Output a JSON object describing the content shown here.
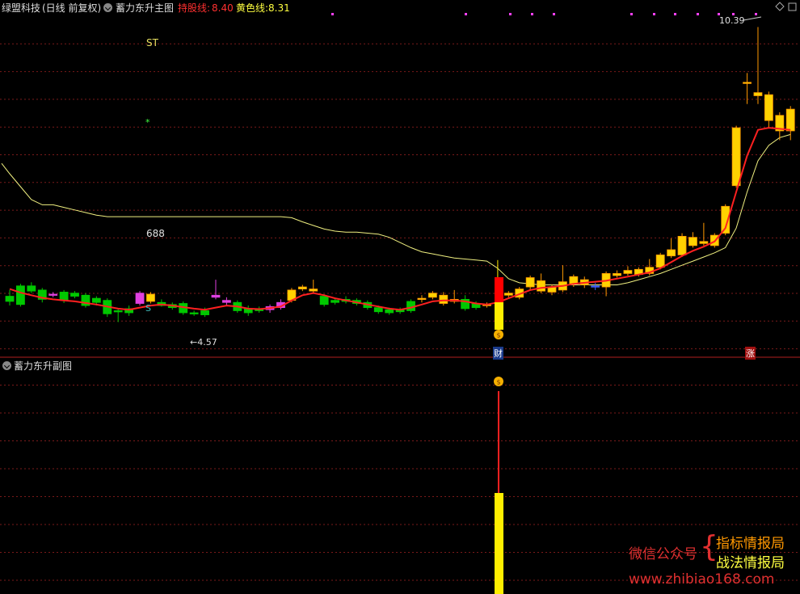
{
  "header": {
    "stock_title": "绿盟科技",
    "period": "(日线 前复权)",
    "indicator_main": "蓄力东升主图",
    "hold_line_label": "持股线:",
    "hold_line_value": "8.40",
    "yellow_line_label": "黄色线:",
    "yellow_line_value": "8.31",
    "indicator_sub": "蓄力东升副图"
  },
  "annotations": {
    "st": "ST",
    "star": "*",
    "num688": "688",
    "s": "S",
    "low_label": "←4.57",
    "high_label": "10.39",
    "cai": "财",
    "zhang": "涨"
  },
  "watermark": {
    "wechat": "微信公众号",
    "brace": "{",
    "line1": "指标情报局",
    "line2": "战法情报局",
    "url": "www.zhibiao168.com"
  },
  "colors": {
    "up": "#ffd200",
    "up_border": "#ff9800",
    "down": "#00c800",
    "magenta": "#e040e0",
    "red_line": "#ff2020",
    "yellow_line": "#f0f080",
    "grid": "#7a1a1a"
  },
  "chart_data": {
    "type": "candlestick",
    "y_range": [
      4.0,
      10.6
    ],
    "candles": [
      {
        "o": 5.08,
        "c": 5.18,
        "h": 5.3,
        "l": 5.0,
        "k": "g"
      },
      {
        "o": 5.38,
        "c": 5.02,
        "h": 5.42,
        "l": 4.98,
        "k": "g"
      },
      {
        "o": 5.38,
        "c": 5.28,
        "h": 5.45,
        "l": 5.24,
        "k": "g"
      },
      {
        "o": 5.3,
        "c": 5.12,
        "h": 5.34,
        "l": 5.06,
        "k": "g"
      },
      {
        "o": 5.22,
        "c": 5.2,
        "h": 5.26,
        "l": 5.16,
        "k": "m"
      },
      {
        "o": 5.26,
        "c": 5.1,
        "h": 5.3,
        "l": 5.05,
        "k": "g"
      },
      {
        "o": 5.24,
        "c": 5.18,
        "h": 5.28,
        "l": 5.14,
        "k": "g"
      },
      {
        "o": 5.2,
        "c": 5.0,
        "h": 5.24,
        "l": 4.96,
        "k": "g"
      },
      {
        "o": 5.14,
        "c": 5.06,
        "h": 5.18,
        "l": 5.0,
        "k": "g"
      },
      {
        "o": 5.1,
        "c": 4.84,
        "h": 5.14,
        "l": 4.78,
        "k": "g"
      },
      {
        "o": 4.9,
        "c": 4.88,
        "h": 4.95,
        "l": 4.68,
        "k": "g"
      },
      {
        "o": 4.94,
        "c": 4.86,
        "h": 5.0,
        "l": 4.8,
        "k": "g"
      },
      {
        "o": 5.04,
        "c": 5.24,
        "h": 5.28,
        "l": 5.0,
        "k": "m"
      },
      {
        "o": 5.08,
        "c": 5.22,
        "h": 5.26,
        "l": 5.04,
        "k": "y"
      },
      {
        "o": 5.06,
        "c": 5.0,
        "h": 5.12,
        "l": 4.98,
        "k": "g"
      },
      {
        "o": 5.02,
        "c": 4.96,
        "h": 5.06,
        "l": 4.92,
        "k": "g"
      },
      {
        "o": 5.04,
        "c": 4.86,
        "h": 5.08,
        "l": 4.82,
        "k": "g"
      },
      {
        "o": 4.86,
        "c": 4.84,
        "h": 4.9,
        "l": 4.8,
        "k": "g"
      },
      {
        "o": 4.9,
        "c": 4.82,
        "h": 4.96,
        "l": 4.78,
        "k": "g"
      },
      {
        "o": 5.16,
        "c": 5.2,
        "h": 5.5,
        "l": 5.12,
        "k": "m"
      },
      {
        "o": 5.1,
        "c": 5.06,
        "h": 5.16,
        "l": 5.0,
        "k": "m"
      },
      {
        "o": 5.06,
        "c": 4.9,
        "h": 5.1,
        "l": 4.86,
        "k": "g"
      },
      {
        "o": 4.94,
        "c": 4.86,
        "h": 5.0,
        "l": 4.8,
        "k": "g"
      },
      {
        "o": 4.94,
        "c": 4.9,
        "h": 4.98,
        "l": 4.86,
        "k": "g"
      },
      {
        "o": 4.98,
        "c": 4.92,
        "h": 5.02,
        "l": 4.86,
        "k": "m"
      },
      {
        "o": 5.06,
        "c": 4.96,
        "h": 5.12,
        "l": 4.92,
        "k": "m"
      },
      {
        "o": 5.1,
        "c": 5.3,
        "h": 5.34,
        "l": 5.06,
        "k": "y"
      },
      {
        "o": 5.32,
        "c": 5.36,
        "h": 5.4,
        "l": 5.28,
        "k": "y"
      },
      {
        "o": 5.28,
        "c": 5.32,
        "h": 5.5,
        "l": 5.24,
        "k": "y"
      },
      {
        "o": 5.18,
        "c": 5.02,
        "h": 5.22,
        "l": 4.98,
        "k": "g"
      },
      {
        "o": 5.1,
        "c": 5.06,
        "h": 5.14,
        "l": 5.02,
        "k": "g"
      },
      {
        "o": 5.12,
        "c": 5.08,
        "h": 5.18,
        "l": 5.04,
        "k": "g"
      },
      {
        "o": 5.1,
        "c": 5.04,
        "h": 5.14,
        "l": 5.0,
        "k": "g"
      },
      {
        "o": 5.06,
        "c": 4.96,
        "h": 5.1,
        "l": 4.92,
        "k": "g"
      },
      {
        "o": 4.96,
        "c": 4.88,
        "h": 5.0,
        "l": 4.84,
        "k": "g"
      },
      {
        "o": 4.92,
        "c": 4.86,
        "h": 4.96,
        "l": 4.82,
        "k": "g"
      },
      {
        "o": 4.92,
        "c": 4.88,
        "h": 4.96,
        "l": 4.84,
        "k": "g"
      },
      {
        "o": 5.08,
        "c": 4.9,
        "h": 5.12,
        "l": 4.86,
        "k": "g"
      },
      {
        "o": 5.12,
        "c": 5.14,
        "h": 5.2,
        "l": 5.06,
        "k": "y"
      },
      {
        "o": 5.16,
        "c": 5.24,
        "h": 5.28,
        "l": 5.12,
        "k": "y"
      },
      {
        "o": 5.04,
        "c": 5.2,
        "h": 5.26,
        "l": 5.0,
        "k": "y"
      },
      {
        "o": 5.08,
        "c": 5.12,
        "h": 5.3,
        "l": 5.04,
        "k": "y"
      },
      {
        "o": 5.12,
        "c": 4.94,
        "h": 5.2,
        "l": 4.9,
        "k": "g"
      },
      {
        "o": 5.04,
        "c": 4.96,
        "h": 5.08,
        "l": 4.92,
        "k": "g"
      },
      {
        "o": 5.0,
        "c": 5.02,
        "h": 5.06,
        "l": 4.96,
        "k": "y"
      },
      {
        "o": 5.06,
        "c": 5.84,
        "h": 5.88,
        "l": 5.0,
        "k": "r"
      },
      {
        "o": 5.2,
        "c": 5.24,
        "h": 5.28,
        "l": 5.16,
        "k": "y"
      },
      {
        "o": 5.16,
        "c": 5.32,
        "h": 5.36,
        "l": 5.12,
        "k": "y"
      },
      {
        "o": 5.36,
        "c": 5.54,
        "h": 5.58,
        "l": 5.3,
        "k": "y"
      },
      {
        "o": 5.28,
        "c": 5.48,
        "h": 5.62,
        "l": 5.24,
        "k": "y"
      },
      {
        "o": 5.26,
        "c": 5.36,
        "h": 5.4,
        "l": 5.2,
        "k": "y"
      },
      {
        "o": 5.3,
        "c": 5.46,
        "h": 5.78,
        "l": 5.26,
        "k": "y"
      },
      {
        "o": 5.42,
        "c": 5.56,
        "h": 5.6,
        "l": 5.36,
        "k": "y"
      },
      {
        "o": 5.4,
        "c": 5.5,
        "h": 5.56,
        "l": 5.34,
        "k": "y"
      },
      {
        "o": 5.36,
        "c": 5.38,
        "h": 5.44,
        "l": 5.3,
        "k": "b"
      },
      {
        "o": 5.36,
        "c": 5.62,
        "h": 5.66,
        "l": 5.18,
        "k": "y"
      },
      {
        "o": 5.58,
        "c": 5.62,
        "h": 5.68,
        "l": 5.54,
        "k": "y"
      },
      {
        "o": 5.62,
        "c": 5.68,
        "h": 5.76,
        "l": 5.58,
        "k": "y"
      },
      {
        "o": 5.6,
        "c": 5.7,
        "h": 5.74,
        "l": 5.56,
        "k": "y"
      },
      {
        "o": 5.62,
        "c": 5.74,
        "h": 5.9,
        "l": 5.58,
        "k": "y"
      },
      {
        "o": 5.74,
        "c": 5.98,
        "h": 6.02,
        "l": 5.7,
        "k": "y"
      },
      {
        "o": 5.96,
        "c": 6.08,
        "h": 6.3,
        "l": 5.92,
        "k": "y"
      },
      {
        "o": 5.98,
        "c": 6.34,
        "h": 6.4,
        "l": 5.94,
        "k": "y"
      },
      {
        "o": 6.16,
        "c": 6.32,
        "h": 6.42,
        "l": 6.12,
        "k": "y"
      },
      {
        "o": 6.2,
        "c": 6.24,
        "h": 6.6,
        "l": 6.16,
        "k": "y"
      },
      {
        "o": 6.16,
        "c": 6.36,
        "h": 6.4,
        "l": 6.12,
        "k": "y"
      },
      {
        "o": 6.4,
        "c": 6.92,
        "h": 6.96,
        "l": 6.36,
        "k": "y"
      },
      {
        "o": 7.32,
        "c": 8.44,
        "h": 8.48,
        "l": 7.28,
        "k": "y"
      },
      {
        "o": 9.3,
        "c": 9.32,
        "h": 9.5,
        "l": 8.9,
        "k": "y"
      },
      {
        "o": 9.06,
        "c": 9.12,
        "h": 10.39,
        "l": 8.9,
        "k": "y"
      },
      {
        "o": 8.58,
        "c": 9.08,
        "h": 9.14,
        "l": 8.44,
        "k": "y"
      },
      {
        "o": 8.68,
        "c": 8.38,
        "h": 8.74,
        "l": 8.2,
        "k": "y"
      },
      {
        "o": 8.38,
        "c": 8.8,
        "h": 8.86,
        "l": 8.2,
        "k": "y"
      }
    ],
    "hold_line": [
      5.32,
      5.25,
      5.2,
      5.15,
      5.12,
      5.1,
      5.08,
      5.05,
      5.02,
      4.98,
      4.94,
      4.92,
      4.96,
      5.0,
      5.02,
      5.0,
      4.97,
      4.94,
      4.92,
      4.96,
      5.0,
      4.98,
      4.94,
      4.93,
      4.95,
      4.98,
      5.1,
      5.2,
      5.24,
      5.2,
      5.14,
      5.1,
      5.06,
      5.02,
      4.98,
      4.94,
      4.92,
      4.96,
      5.02,
      5.08,
      5.1,
      5.1,
      5.08,
      5.04,
      5.02,
      5.06,
      5.14,
      5.22,
      5.3,
      5.34,
      5.36,
      5.38,
      5.42,
      5.44,
      5.46,
      5.48,
      5.52,
      5.56,
      5.6,
      5.64,
      5.72,
      5.84,
      5.96,
      6.06,
      6.14,
      6.24,
      6.5,
      7.2,
      7.9,
      8.4,
      8.44,
      8.42,
      8.4
    ],
    "yellow_line": [
      7.55,
      7.3,
      7.05,
      6.95,
      6.95,
      6.9,
      6.85,
      6.8,
      6.75,
      6.72,
      6.72,
      6.72,
      6.72,
      6.72,
      6.72,
      6.72,
      6.72,
      6.72,
      6.72,
      6.72,
      6.72,
      6.72,
      6.72,
      6.72,
      6.72,
      6.72,
      6.7,
      6.62,
      6.55,
      6.48,
      6.44,
      6.42,
      6.42,
      6.4,
      6.38,
      6.32,
      6.22,
      6.12,
      6.04,
      6.0,
      5.96,
      5.92,
      5.9,
      5.88,
      5.86,
      5.72,
      5.52,
      5.44,
      5.42,
      5.4,
      5.4,
      5.4,
      5.4,
      5.4,
      5.4,
      5.4,
      5.4,
      5.44,
      5.5,
      5.56,
      5.62,
      5.7,
      5.78,
      5.86,
      5.94,
      6.02,
      6.12,
      6.5,
      7.2,
      7.8,
      8.1,
      8.25,
      8.31
    ]
  }
}
